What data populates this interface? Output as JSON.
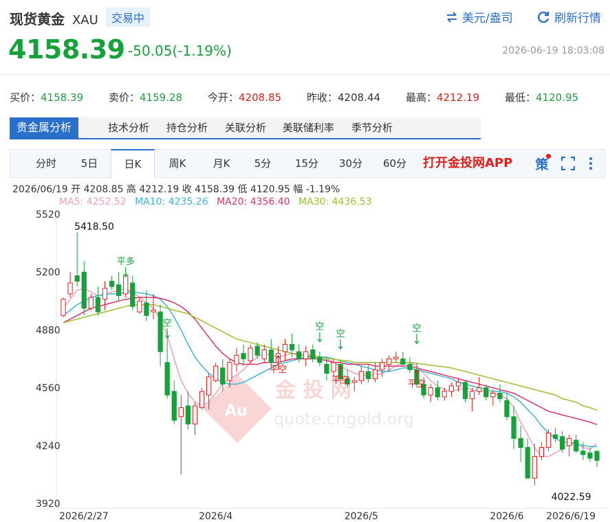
{
  "header": {
    "title": "现货黄金",
    "code": "XAU",
    "status_badge": "交易中",
    "currency_link": "美元/盎司",
    "refresh_link": "刷新行情"
  },
  "quote": {
    "price": "4158.39",
    "change": "-50.05(-1.19%)",
    "timestamp": "2026-06-19 18:03:08"
  },
  "stats": [
    {
      "label": "买价：",
      "value": "4158.39",
      "color": "green"
    },
    {
      "label": "卖价：",
      "value": "4159.28",
      "color": "green"
    },
    {
      "label": "今开：",
      "value": "4208.85",
      "color": "red"
    },
    {
      "label": "昨收：",
      "value": "4208.44",
      "color": "dark"
    },
    {
      "label": "最高：",
      "value": "4212.19",
      "color": "red"
    },
    {
      "label": "最低：",
      "value": "4120.95",
      "color": "green"
    }
  ],
  "analysis_tabs": [
    "贵金属分析",
    "技术分析",
    "持仓分析",
    "关联分析",
    "美联储利率",
    "季节分析"
  ],
  "period_tabs": [
    "分时",
    "5日",
    "日K",
    "周K",
    "月K",
    "5分",
    "15分",
    "30分",
    "60分"
  ],
  "active_period": "日K",
  "promo": "打开金投网APP",
  "strategy_label": "策",
  "ohlc_line": "2026/06/19  开 4208.85  高 4212.19  收 4158.39  低 4120.95  幅 -1.19%",
  "ma": [
    {
      "label": "MA5: 4252.52",
      "color": "#f0a0b8"
    },
    {
      "label": "MA10: 4235.26",
      "color": "#3bb5d6"
    },
    {
      "label": "MA20: 4356.40",
      "color": "#e0306a"
    },
    {
      "label": "MA30: 4436.53",
      "color": "#9cbf2a"
    }
  ],
  "watermark": {
    "text": "金 投 网",
    "url": "quote.cngold.org",
    "logo": "Au"
  },
  "colors": {
    "up": "#e0201c",
    "down": "#17a13b",
    "accent": "#2a6fc9"
  },
  "chart_data": {
    "type": "candlestick",
    "y_ticks": [
      5520,
      5200,
      4880,
      4560,
      4240,
      3920
    ],
    "ylim": [
      3920,
      5520
    ],
    "x_tick_labels": [
      {
        "label": "2026/2/27",
        "index": 0
      },
      {
        "label": "2026/4",
        "index": 22
      },
      {
        "label": "2026/5",
        "index": 43
      },
      {
        "label": "2026/6",
        "index": 64
      },
      {
        "label": "2026/6/19",
        "index": 77
      }
    ],
    "annotations": [
      {
        "text": "5418.50",
        "type": "high",
        "index": 1,
        "value": 5418.5
      },
      {
        "text": "4022.59",
        "type": "low",
        "index": 72,
        "value": 4022.59
      },
      {
        "text": "平多",
        "dir": "down",
        "index": 9,
        "value": 5190
      },
      {
        "text": "空",
        "dir": "down",
        "index": 15,
        "value": 4850
      },
      {
        "text": "平空",
        "dir": "up",
        "index": 31,
        "value": 4700
      },
      {
        "text": "空",
        "dir": "down",
        "index": 37,
        "value": 4830
      },
      {
        "text": "空",
        "dir": "down",
        "index": 40,
        "value": 4790
      },
      {
        "text": "平空",
        "dir": "up",
        "index": 40,
        "value": 4640
      },
      {
        "text": "空",
        "dir": "down",
        "index": 51,
        "value": 4820
      },
      {
        "text": "平空",
        "dir": "up",
        "index": 51,
        "value": 4620
      }
    ],
    "candles": [
      [
        4960,
        5060,
        4950,
        5050
      ],
      [
        5080,
        5200,
        5060,
        5140
      ],
      [
        5180,
        5420,
        5120,
        5150
      ],
      [
        5200,
        5260,
        4960,
        5000
      ],
      [
        5000,
        5080,
        4990,
        5060
      ],
      [
        5060,
        5120,
        4960,
        4980
      ],
      [
        5050,
        5150,
        4990,
        5110
      ],
      [
        5150,
        5180,
        5100,
        5120
      ],
      [
        5130,
        5200,
        5040,
        5070
      ],
      [
        5080,
        5200,
        5060,
        5180
      ],
      [
        5140,
        5180,
        4990,
        5010
      ],
      [
        4980,
        5060,
        4970,
        5040
      ],
      [
        5030,
        5100,
        4930,
        4960
      ],
      [
        4980,
        5080,
        4940,
        4990
      ],
      [
        4980,
        5020,
        4680,
        4760
      ],
      [
        4700,
        4830,
        4500,
        4520
      ],
      [
        4540,
        4600,
        4360,
        4380
      ],
      [
        4400,
        4520,
        4080,
        4450
      ],
      [
        4460,
        4540,
        4330,
        4360
      ],
      [
        4360,
        4480,
        4300,
        4460
      ],
      [
        4450,
        4560,
        4440,
        4540
      ],
      [
        4520,
        4640,
        4440,
        4620
      ],
      [
        4600,
        4700,
        4590,
        4680
      ],
      [
        4670,
        4720,
        4540,
        4580
      ],
      [
        4600,
        4720,
        4560,
        4700
      ],
      [
        4690,
        4780,
        4650,
        4740
      ],
      [
        4750,
        4800,
        4680,
        4720
      ],
      [
        4710,
        4800,
        4690,
        4780
      ],
      [
        4790,
        4810,
        4720,
        4740
      ],
      [
        4720,
        4800,
        4700,
        4770
      ],
      [
        4770,
        4830,
        4680,
        4700
      ],
      [
        4700,
        4790,
        4660,
        4750
      ],
      [
        4760,
        4830,
        4710,
        4800
      ],
      [
        4800,
        4860,
        4730,
        4770
      ],
      [
        4760,
        4800,
        4700,
        4720
      ],
      [
        4720,
        4790,
        4680,
        4760
      ],
      [
        4770,
        4800,
        4700,
        4720
      ],
      [
        4730,
        4760,
        4680,
        4700
      ],
      [
        4690,
        4730,
        4600,
        4640
      ],
      [
        4650,
        4720,
        4620,
        4700
      ],
      [
        4690,
        4720,
        4580,
        4610
      ],
      [
        4610,
        4660,
        4560,
        4580
      ],
      [
        4590,
        4620,
        4540,
        4600
      ],
      [
        4600,
        4680,
        4580,
        4650
      ],
      [
        4650,
        4690,
        4590,
        4610
      ],
      [
        4610,
        4700,
        4590,
        4660
      ],
      [
        4660,
        4720,
        4620,
        4700
      ],
      [
        4690,
        4740,
        4650,
        4720
      ],
      [
        4720,
        4760,
        4700,
        4730
      ],
      [
        4720,
        4760,
        4680,
        4690
      ],
      [
        4690,
        4730,
        4640,
        4660
      ],
      [
        4660,
        4700,
        4560,
        4580
      ],
      [
        4580,
        4620,
        4500,
        4520
      ],
      [
        4520,
        4580,
        4480,
        4560
      ],
      [
        4560,
        4600,
        4490,
        4510
      ],
      [
        4510,
        4560,
        4490,
        4540
      ],
      [
        4540,
        4590,
        4510,
        4570
      ],
      [
        4570,
        4610,
        4540,
        4590
      ],
      [
        4590,
        4600,
        4480,
        4500
      ],
      [
        4500,
        4560,
        4430,
        4540
      ],
      [
        4540,
        4620,
        4520,
        4560
      ],
      [
        4560,
        4580,
        4490,
        4510
      ],
      [
        4510,
        4550,
        4460,
        4530
      ],
      [
        4530,
        4580,
        4480,
        4500
      ],
      [
        4490,
        4530,
        4380,
        4400
      ],
      [
        4400,
        4460,
        4220,
        4280
      ],
      [
        4280,
        4350,
        4150,
        4230
      ],
      [
        4230,
        4280,
        4070,
        4060
      ],
      [
        4060,
        4250,
        4020,
        4180
      ],
      [
        4180,
        4260,
        4160,
        4230
      ],
      [
        4230,
        4330,
        4210,
        4310
      ],
      [
        4300,
        4340,
        4260,
        4280
      ],
      [
        4290,
        4320,
        4200,
        4220
      ],
      [
        4240,
        4300,
        4180,
        4280
      ],
      [
        4270,
        4300,
        4200,
        4210
      ],
      [
        4210,
        4260,
        4160,
        4190
      ],
      [
        4200,
        4230,
        4150,
        4170
      ],
      [
        4208.85,
        4212.19,
        4120.95,
        4158.39
      ]
    ],
    "ma_series": {
      "MA5": [
        5000,
        5050,
        5100,
        5110,
        5090,
        5070,
        5080,
        5090,
        5100,
        5110,
        5090,
        5060,
        5030,
        5000,
        4940,
        4850,
        4720,
        4600,
        4530,
        4480,
        4460,
        4480,
        4530,
        4580,
        4610,
        4630,
        4660,
        4700,
        4730,
        4750,
        4740,
        4730,
        4740,
        4750,
        4750,
        4740,
        4740,
        4730,
        4720,
        4700,
        4680,
        4660,
        4640,
        4630,
        4630,
        4630,
        4640,
        4660,
        4680,
        4700,
        4700,
        4680,
        4640,
        4600,
        4570,
        4550,
        4540,
        4550,
        4560,
        4550,
        4540,
        4540,
        4530,
        4520,
        4500,
        4450,
        4370,
        4300,
        4230,
        4180,
        4180,
        4200,
        4220,
        4250,
        4250,
        4230,
        4220,
        4252.52
      ],
      "MA10": [
        4960,
        4990,
        5020,
        5040,
        5060,
        5070,
        5075,
        5080,
        5080,
        5090,
        5090,
        5085,
        5080,
        5070,
        5050,
        5010,
        4950,
        4880,
        4800,
        4730,
        4680,
        4640,
        4610,
        4590,
        4580,
        4580,
        4590,
        4610,
        4630,
        4650,
        4670,
        4690,
        4700,
        4710,
        4720,
        4730,
        4730,
        4730,
        4730,
        4720,
        4710,
        4700,
        4690,
        4680,
        4670,
        4660,
        4650,
        4650,
        4660,
        4670,
        4670,
        4660,
        4650,
        4640,
        4630,
        4620,
        4610,
        4590,
        4580,
        4570,
        4560,
        4550,
        4540,
        4540,
        4530,
        4510,
        4480,
        4440,
        4400,
        4350,
        4310,
        4280,
        4260,
        4260,
        4250,
        4240,
        4235,
        4235.26
      ],
      "MA20": [
        4920,
        4940,
        4960,
        4980,
        5000,
        5010,
        5020,
        5030,
        5040,
        5050,
        5055,
        5060,
        5060,
        5060,
        5055,
        5045,
        5030,
        5010,
        4980,
        4940,
        4890,
        4840,
        4790,
        4750,
        4720,
        4700,
        4690,
        4690,
        4690,
        4700,
        4700,
        4700,
        4710,
        4720,
        4720,
        4720,
        4720,
        4720,
        4710,
        4700,
        4700,
        4690,
        4690,
        4690,
        4690,
        4680,
        4680,
        4680,
        4680,
        4680,
        4680,
        4670,
        4660,
        4650,
        4640,
        4630,
        4620,
        4610,
        4600,
        4590,
        4580,
        4570,
        4560,
        4550,
        4540,
        4530,
        4510,
        4490,
        4470,
        4450,
        4430,
        4420,
        4410,
        4400,
        4390,
        4380,
        4370,
        4356.4
      ],
      "MA30": [
        4920,
        4930,
        4940,
        4950,
        4960,
        4970,
        4980,
        4990,
        5000,
        5010,
        5020,
        5020,
        5020,
        5020,
        5010,
        5000,
        4990,
        4980,
        4970,
        4950,
        4930,
        4910,
        4890,
        4870,
        4850,
        4830,
        4820,
        4810,
        4800,
        4790,
        4780,
        4770,
        4760,
        4750,
        4740,
        4740,
        4730,
        4730,
        4720,
        4720,
        4710,
        4710,
        4700,
        4700,
        4700,
        4700,
        4700,
        4700,
        4700,
        4700,
        4700,
        4695,
        4690,
        4685,
        4680,
        4675,
        4670,
        4660,
        4650,
        4640,
        4630,
        4620,
        4610,
        4600,
        4590,
        4580,
        4570,
        4560,
        4550,
        4540,
        4530,
        4520,
        4500,
        4490,
        4480,
        4460,
        4450,
        4436.53
      ]
    }
  }
}
